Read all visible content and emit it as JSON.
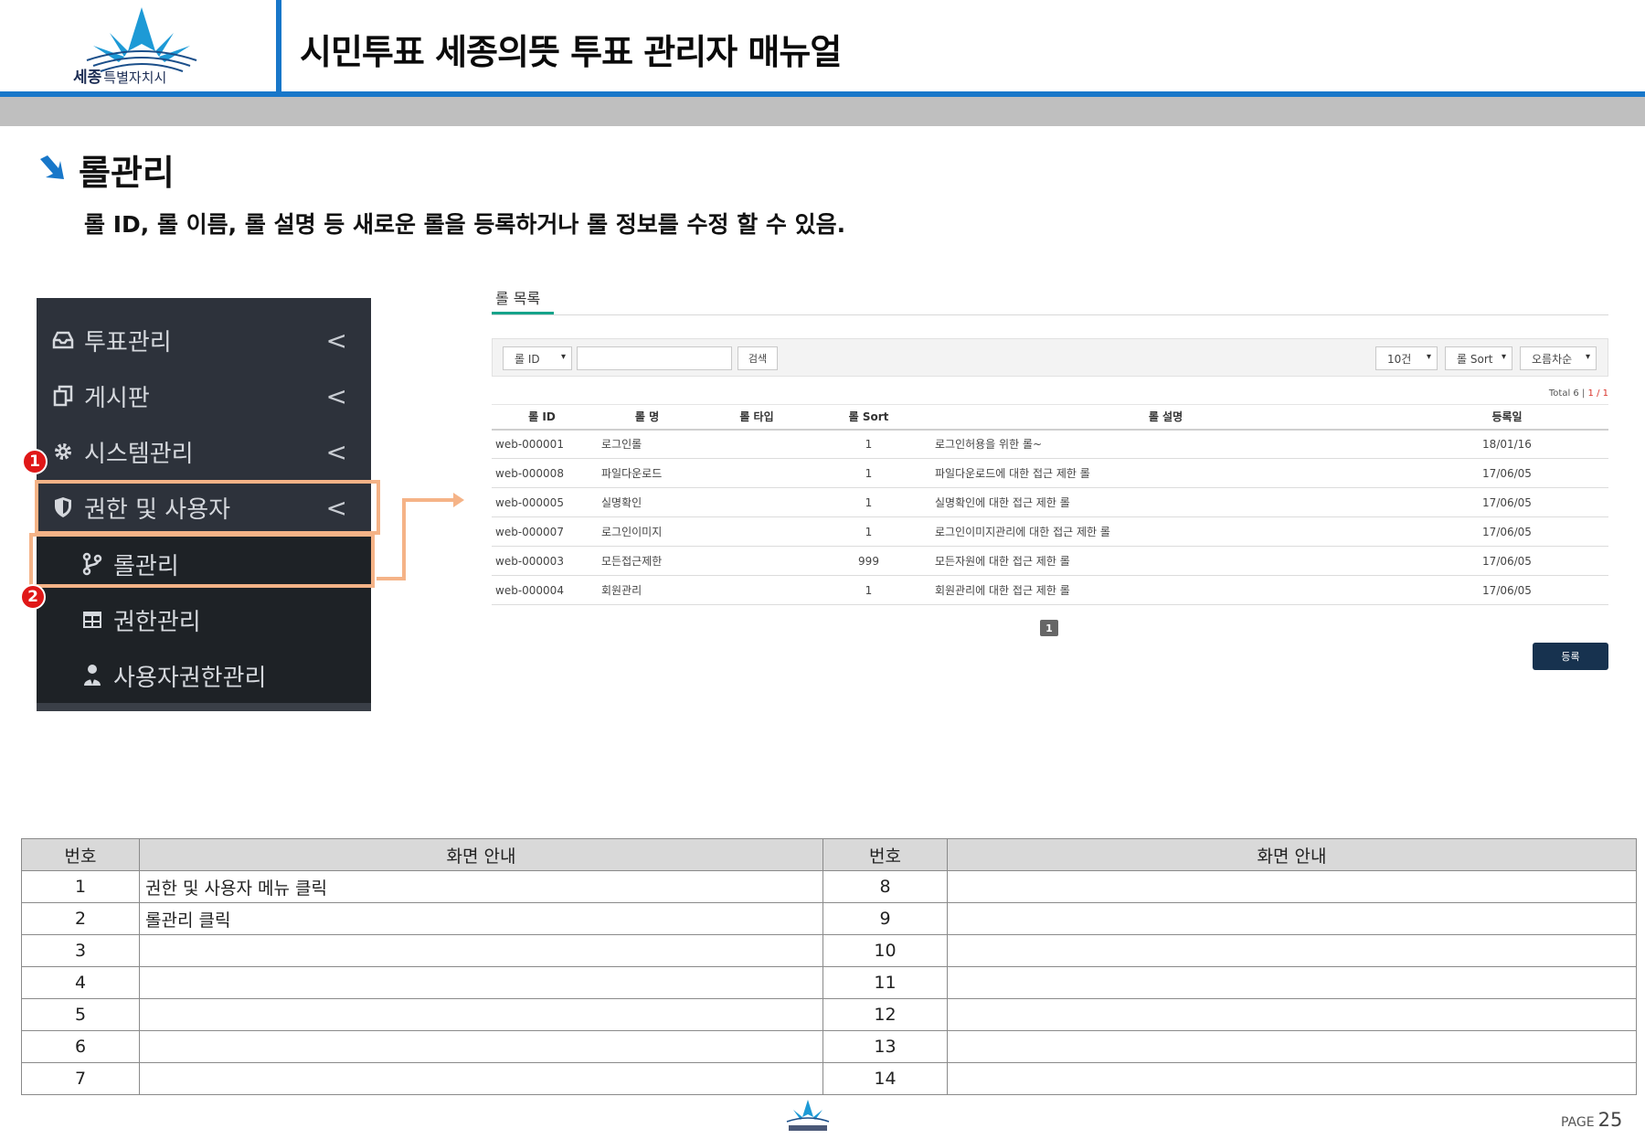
{
  "header": {
    "logo_main": "세종",
    "logo_sub": "특별자치시",
    "title": "시민투표 세종의뜻 투표 관리자 매뉴얼"
  },
  "section": {
    "title": "롤관리",
    "description": "롤 ID, 롤 이름, 롤 설명 등 새로운 롤을 등록하거나 롤 정보를 수정 할 수 있음."
  },
  "sidebar": {
    "items": [
      {
        "label": "투표관리",
        "icon": "inbox-icon"
      },
      {
        "label": "게시판",
        "icon": "copy-icon"
      },
      {
        "label": "시스템관리",
        "icon": "gear-icon"
      },
      {
        "label": "권한 및 사용자",
        "icon": "shield-icon"
      }
    ],
    "sub_items": [
      {
        "label": "롤관리",
        "icon": "branch-icon"
      },
      {
        "label": "권한관리",
        "icon": "table-icon"
      },
      {
        "label": "사용자권한관리",
        "icon": "user-tie-icon"
      }
    ],
    "badges": [
      "1",
      "2"
    ]
  },
  "screen": {
    "tab": "롤 목록",
    "search_select": "롤 ID",
    "search_button": "검색",
    "page_size": "10건",
    "sort_select": "롤 Sort",
    "order_select": "오름차순",
    "total_label": "Total 6",
    "total_sep": "|",
    "page_info": "1 / 1",
    "columns": [
      "롤 ID",
      "롤 명",
      "롤 타입",
      "롤 Sort",
      "롤 설명",
      "등록일"
    ],
    "rows": [
      [
        "web-000001",
        "로그인롤",
        "",
        "1",
        "로그인허용을 위한 롤~",
        "18/01/16"
      ],
      [
        "web-000008",
        "파일다운로드",
        "",
        "1",
        "파일다운로드에 대한 접근 제한 롤",
        "17/06/05"
      ],
      [
        "web-000005",
        "실명확인",
        "",
        "1",
        "실명확인에 대한 접근 제한 롤",
        "17/06/05"
      ],
      [
        "web-000007",
        "로그인이미지",
        "",
        "1",
        "로그인이미지관리에 대한 접근 제한 롤",
        "17/06/05"
      ],
      [
        "web-000003",
        "모든접근제한",
        "",
        "999",
        "모든자원에 대한 접근 제한 롤",
        "17/06/05"
      ],
      [
        "web-000004",
        "회원관리",
        "",
        "1",
        "회원관리에 대한 접근 제한 롤",
        "17/06/05"
      ]
    ],
    "pagination": "1",
    "register_button": "등록"
  },
  "guide_table": {
    "headers": [
      "번호",
      "화면 안내",
      "번호",
      "화면 안내"
    ],
    "rows": [
      [
        "1",
        "권한 및 사용자 메뉴 클릭",
        "8",
        ""
      ],
      [
        "2",
        "롤관리 클릭",
        "9",
        ""
      ],
      [
        "3",
        "",
        "10",
        ""
      ],
      [
        "4",
        "",
        "11",
        ""
      ],
      [
        "5",
        "",
        "12",
        ""
      ],
      [
        "6",
        "",
        "13",
        ""
      ],
      [
        "7",
        "",
        "14",
        ""
      ]
    ]
  },
  "footer": {
    "page_label": "PAGE",
    "page_number": "25"
  },
  "colors": {
    "brand_blue": "#1877c9",
    "highlight_orange": "#f5b387",
    "badge_red": "#e01818",
    "sidebar_bg": "#2d323b",
    "tab_accent": "#16a38a",
    "register_button": "#17324f"
  }
}
